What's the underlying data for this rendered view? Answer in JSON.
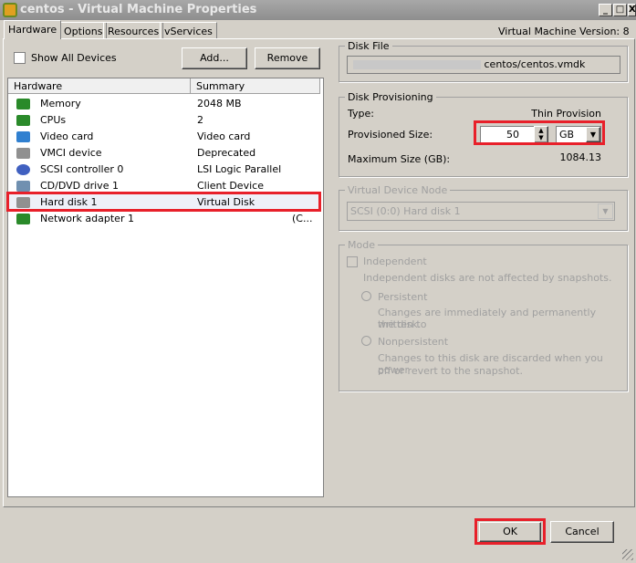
{
  "window": {
    "title": "centos - Virtual Machine Properties",
    "min": "_",
    "max": "□",
    "close": "X"
  },
  "tabs": [
    {
      "label": "Hardware",
      "active": true
    },
    {
      "label": "Options"
    },
    {
      "label": "Resources"
    },
    {
      "label": "vServices"
    }
  ],
  "vm_version": "Virtual Machine Version: 8",
  "left": {
    "show_all_devices": "Show All Devices",
    "show_all_checked": false,
    "add": "Add...",
    "remove": "Remove",
    "columns": [
      "Hardware",
      "Summary"
    ],
    "rows": [
      {
        "name": "Memory",
        "summary": "2048 MB",
        "icon": "memory-icon"
      },
      {
        "name": "CPUs",
        "summary": "2",
        "icon": "cpu-icon"
      },
      {
        "name": "Video card",
        "summary": "Video card",
        "icon": "monitor-icon"
      },
      {
        "name": "VMCI device",
        "summary": "Deprecated",
        "icon": "device-icon"
      },
      {
        "name": "SCSI controller 0",
        "summary": "LSI Logic Parallel",
        "icon": "scsi-icon"
      },
      {
        "name": "CD/DVD drive 1",
        "summary": "Client Device",
        "icon": "cdrom-icon"
      },
      {
        "name": "Hard disk 1",
        "summary": "Virtual Disk",
        "icon": "harddisk-icon",
        "selected": true
      },
      {
        "name": "Network adapter 1",
        "summary": "(C...",
        "icon": "network-icon"
      }
    ]
  },
  "disk_file": {
    "label": "Disk File",
    "value": "centos/centos.vmdk"
  },
  "provisioning": {
    "label": "Disk Provisioning",
    "type_label": "Type:",
    "type_value": "Thin Provision",
    "size_label": "Provisioned Size:",
    "size_value": "50",
    "unit": "GB",
    "max_label": "Maximum Size (GB):",
    "max_value": "1084.13"
  },
  "vdn": {
    "label": "Virtual Device Node",
    "value": "SCSI (0:0) Hard disk 1"
  },
  "mode": {
    "label": "Mode",
    "independent": "Independent",
    "independent_desc": "Independent disks are not affected by snapshots.",
    "persistent": "Persistent",
    "persistent_desc1": "Changes are immediately and permanently written to",
    "persistent_desc2": "the disk.",
    "nonpersistent": "Nonpersistent",
    "nonpersistent_desc1": "Changes to this disk are discarded when you power",
    "nonpersistent_desc2": "off or revert to the snapshot."
  },
  "footer": {
    "ok": "OK",
    "cancel": "Cancel"
  },
  "colors": {
    "highlight": "#e8202a"
  }
}
